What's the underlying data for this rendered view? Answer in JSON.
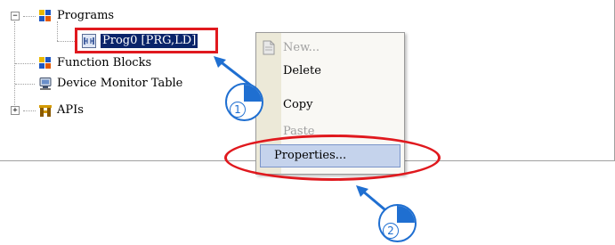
{
  "tree": {
    "nodes": [
      {
        "label": "Programs",
        "expander": "−"
      },
      {
        "label": "Prog0 [PRG,LD]"
      },
      {
        "label": "Function Blocks"
      },
      {
        "label": "Device Monitor Table"
      },
      {
        "label": "APIs",
        "expander": "+"
      }
    ]
  },
  "context_menu": {
    "items": [
      {
        "label": "New...",
        "enabled": false
      },
      {
        "label": "Delete",
        "enabled": true
      },
      {
        "label": "Copy",
        "enabled": true
      },
      {
        "label": "Paste",
        "enabled": false
      },
      {
        "label": "Properties...",
        "enabled": true,
        "highlighted": true
      }
    ]
  },
  "annotations": {
    "step1": "1",
    "step2": "2",
    "highlight_color": "#e0191e",
    "callout_color": "#1f6fd1"
  },
  "icons": [
    "programs-folder-icon",
    "ld-program-icon",
    "function-blocks-folder-icon",
    "device-monitor-icon",
    "apis-folder-icon",
    "document-icon"
  ]
}
